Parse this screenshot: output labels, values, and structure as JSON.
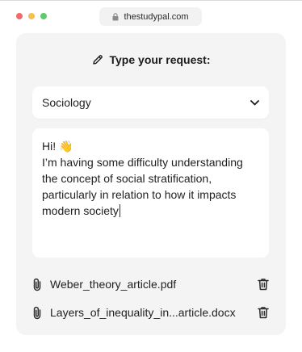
{
  "browser": {
    "url": "thestudypal.com"
  },
  "form": {
    "title": "Type your request:",
    "subject_select": {
      "selected": "Sociology"
    },
    "message": {
      "lines": [
        "Hi! 👋",
        "I’m having some difficulty understanding",
        "the concept of social stratification,",
        "particularly in relation to how it impacts",
        "modern society"
      ]
    },
    "attachments": [
      {
        "name": "Weber_theory_article.pdf"
      },
      {
        "name": "Layers_of_inequality_in...article.docx"
      }
    ]
  },
  "icons": {
    "lock": "lock-icon",
    "pencil": "pencil-icon",
    "chevron": "chevron-down-icon",
    "paperclip": "paperclip-icon",
    "trash": "trash-icon"
  },
  "colors": {
    "panel_bg": "#f4f4f5",
    "red": "#f26a6a",
    "yellow": "#f5c04f",
    "green": "#60c96b"
  }
}
